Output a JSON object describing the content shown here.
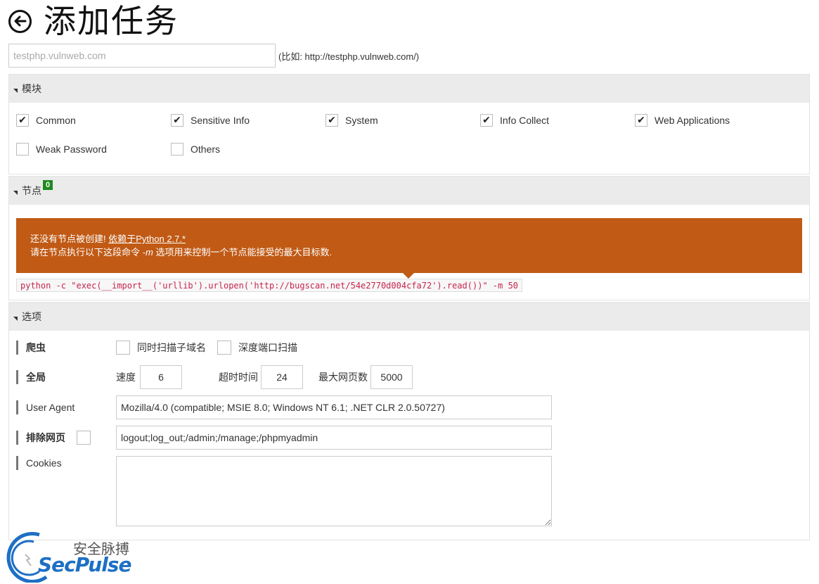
{
  "header": {
    "title": "添加任务",
    "back_icon": "arrow-left-circle-icon"
  },
  "target": {
    "placeholder": "testphp.vulnweb.com",
    "value": "",
    "hint": "(比如: http://testphp.vulnweb.com/)"
  },
  "modules": {
    "title": "模块",
    "items": [
      {
        "label": "Common",
        "checked": true
      },
      {
        "label": "Sensitive Info",
        "checked": true
      },
      {
        "label": "System",
        "checked": true
      },
      {
        "label": "Info Collect",
        "checked": true
      },
      {
        "label": "Web Applications",
        "checked": true
      },
      {
        "label": "Weak Password",
        "checked": false
      },
      {
        "label": "Others",
        "checked": false
      }
    ]
  },
  "nodes": {
    "title": "节点",
    "count": "0",
    "alert_line1": "还没有节点被创建!",
    "alert_link": "依赖于Python 2.7.*",
    "alert_line2_a": "请在节点执行以下这段命令",
    "alert_line2_flag": "-m",
    "alert_line2_b": "选项用来控制一个节点能接受的最大目标数.",
    "command": "python -c \"exec(__import__('urllib').urlopen('http://bugscan.net/54e2770d004cfa72').read())\" -m 50"
  },
  "options": {
    "title": "选项",
    "crawler": {
      "label": "爬虫",
      "sub_domain": "同时扫描子域名",
      "deep_port": "深度端口扫描"
    },
    "global": {
      "label": "全局",
      "speed_label": "速度",
      "speed": "6",
      "timeout_label": "超时时间",
      "timeout": "24",
      "max_pages_label": "最大网页数",
      "max_pages": "5000"
    },
    "user_agent": {
      "label": "User Agent",
      "value": "Mozilla/4.0 (compatible; MSIE 8.0; Windows NT 6.1; .NET CLR 2.0.50727)"
    },
    "exclude": {
      "label": "排除网页",
      "value": "logout;log_out;/admin;/manage;/phpmyadmin"
    },
    "cookies": {
      "label": "Cookies",
      "value": ""
    }
  },
  "watermark": {
    "cn": "安全脉搏",
    "en": "SecPulse"
  },
  "colors": {
    "alert": "#c05a15",
    "badge": "#1f8a1f",
    "command_text": "#c7254e"
  }
}
